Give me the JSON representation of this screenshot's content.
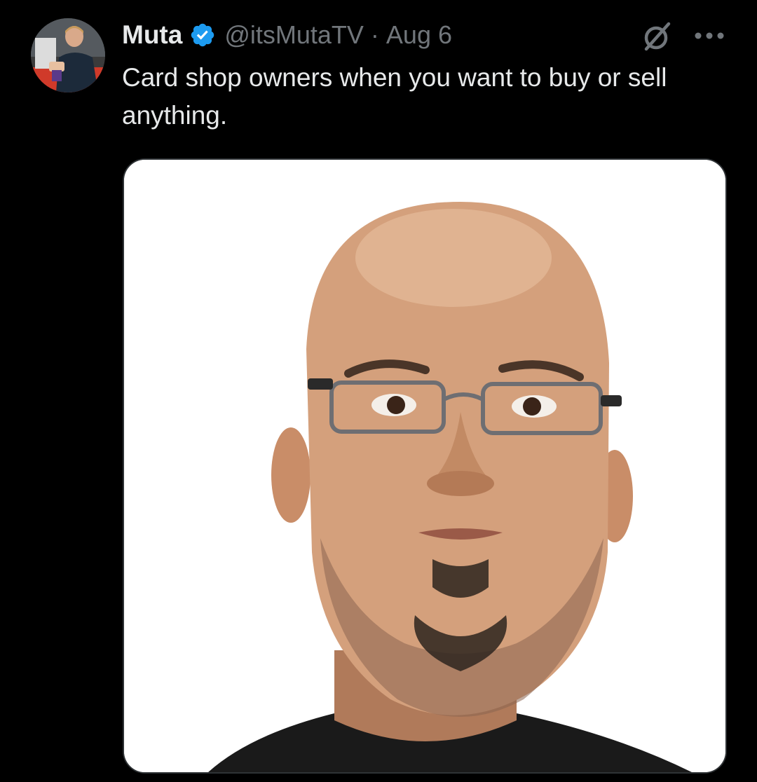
{
  "post": {
    "author_name": "Muta",
    "author_handle": "@itsMutaTV",
    "separator": "·",
    "date": "Aug 6",
    "text": "Card shop owners when you want to buy or sell anything."
  },
  "icons": {
    "verified": "verified-badge-icon",
    "grok": "grok-icon",
    "more": "more-options-icon"
  },
  "colors": {
    "background": "#000000",
    "text_primary": "#e7e9ea",
    "text_secondary": "#71767b",
    "verified_blue": "#1d9bf0"
  }
}
